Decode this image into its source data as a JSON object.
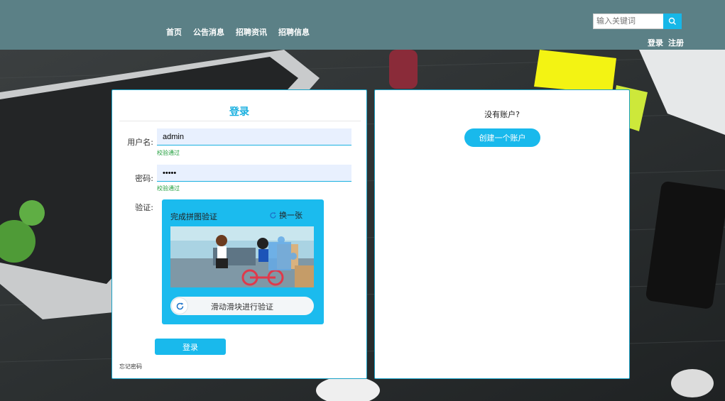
{
  "header": {
    "nav": [
      "首页",
      "公告消息",
      "招聘资讯",
      "招聘信息"
    ],
    "search": {
      "placeholder": "输入关键词"
    },
    "login_link": "登录",
    "register_link": "注册"
  },
  "login": {
    "title": "登录",
    "username_label": "用户名:",
    "username_value": "admin",
    "username_hint": "校验通过",
    "password_label": "密码:",
    "password_value": "admin",
    "password_hint": "校验通过",
    "verify_label": "验证:",
    "captcha": {
      "title": "完成拼图验证",
      "refresh_label": "换一张",
      "slider_text": "滑动滑块进行验证"
    },
    "submit_label": "登录",
    "forgot_label": "忘记密码"
  },
  "register": {
    "question": "没有账户?",
    "create_label": "创建一个账户"
  },
  "colors": {
    "header": "#5b8086",
    "accent": "#19b9ec",
    "valid": "#1e9d3a"
  }
}
